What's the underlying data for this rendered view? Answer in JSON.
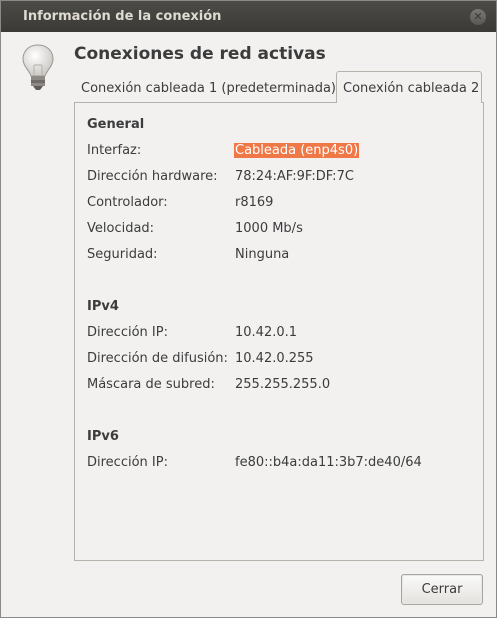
{
  "window": {
    "title": "Información de la conexión"
  },
  "heading": "Conexiones de red activas",
  "tabs": [
    {
      "label": "Conexión cableada 1 (predeterminada)",
      "active": false
    },
    {
      "label": "Conexión cableada 2",
      "active": true
    }
  ],
  "general": {
    "title": "General",
    "rows": [
      {
        "label": "Interfaz:",
        "value": "Cableada (enp4s0)"
      },
      {
        "label": "Dirección hardware:",
        "value": "78:24:AF:9F:DF:7C"
      },
      {
        "label": "Controlador:",
        "value": "r8169"
      },
      {
        "label": "Velocidad:",
        "value": "1000 Mb/s"
      },
      {
        "label": "Seguridad:",
        "value": "Ninguna"
      }
    ]
  },
  "ipv4": {
    "title": "IPv4",
    "rows": [
      {
        "label": "Dirección IP:",
        "value": "10.42.0.1"
      },
      {
        "label": "Dirección de difusión:",
        "value": "10.42.0.255"
      },
      {
        "label": "Máscara de subred:",
        "value": "255.255.255.0"
      }
    ]
  },
  "ipv6": {
    "title": "IPv6",
    "rows": [
      {
        "label": "Dirección IP:",
        "value": "fe80::b4a:da11:3b7:de40/64"
      }
    ]
  },
  "buttons": {
    "close_label": "Cerrar"
  },
  "colors": {
    "titlebar": "#3c3b37",
    "selection": "#f07746",
    "background": "#f2f1f0"
  },
  "icons": {
    "close": "close-icon",
    "bulb": "lightbulb-icon"
  }
}
